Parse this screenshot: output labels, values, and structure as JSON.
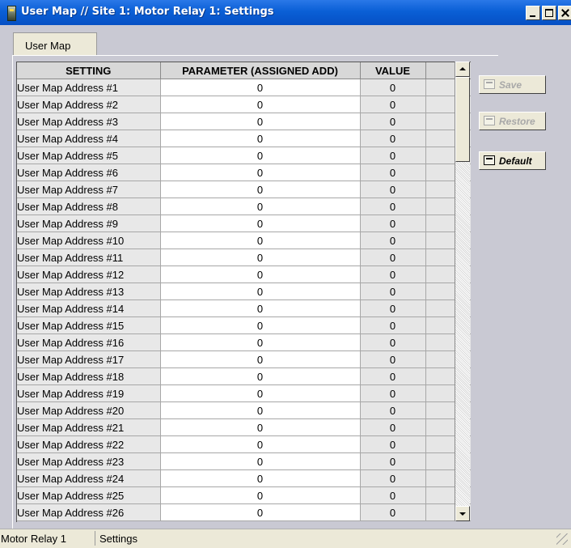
{
  "window": {
    "title": "User Map // Site 1: Motor Relay 1: Settings"
  },
  "tabs": [
    {
      "label": "User Map"
    }
  ],
  "table": {
    "columns": [
      "SETTING",
      "PARAMETER  (ASSIGNED ADD)",
      "VALUE",
      ""
    ],
    "rows": [
      {
        "setting": "User Map Address #1",
        "parameter": "0",
        "value": "0"
      },
      {
        "setting": "User Map Address #2",
        "parameter": "0",
        "value": "0"
      },
      {
        "setting": "User Map Address #3",
        "parameter": "0",
        "value": "0"
      },
      {
        "setting": "User Map Address #4",
        "parameter": "0",
        "value": "0"
      },
      {
        "setting": "User Map Address #5",
        "parameter": "0",
        "value": "0"
      },
      {
        "setting": "User Map Address #6",
        "parameter": "0",
        "value": "0"
      },
      {
        "setting": "User Map Address #7",
        "parameter": "0",
        "value": "0"
      },
      {
        "setting": "User Map Address #8",
        "parameter": "0",
        "value": "0"
      },
      {
        "setting": "User Map Address #9",
        "parameter": "0",
        "value": "0"
      },
      {
        "setting": "User Map Address #10",
        "parameter": "0",
        "value": "0"
      },
      {
        "setting": "User Map Address #11",
        "parameter": "0",
        "value": "0"
      },
      {
        "setting": "User Map Address #12",
        "parameter": "0",
        "value": "0"
      },
      {
        "setting": "User Map Address #13",
        "parameter": "0",
        "value": "0"
      },
      {
        "setting": "User Map Address #14",
        "parameter": "0",
        "value": "0"
      },
      {
        "setting": "User Map Address #15",
        "parameter": "0",
        "value": "0"
      },
      {
        "setting": "User Map Address #16",
        "parameter": "0",
        "value": "0"
      },
      {
        "setting": "User Map Address #17",
        "parameter": "0",
        "value": "0"
      },
      {
        "setting": "User Map Address #18",
        "parameter": "0",
        "value": "0"
      },
      {
        "setting": "User Map Address #19",
        "parameter": "0",
        "value": "0"
      },
      {
        "setting": "User Map Address #20",
        "parameter": "0",
        "value": "0"
      },
      {
        "setting": "User Map Address #21",
        "parameter": "0",
        "value": "0"
      },
      {
        "setting": "User Map Address #22",
        "parameter": "0",
        "value": "0"
      },
      {
        "setting": "User Map Address #23",
        "parameter": "0",
        "value": "0"
      },
      {
        "setting": "User Map Address #24",
        "parameter": "0",
        "value": "0"
      },
      {
        "setting": "User Map Address #25",
        "parameter": "0",
        "value": "0"
      },
      {
        "setting": "User Map Address #26",
        "parameter": "0",
        "value": "0"
      }
    ]
  },
  "buttons": {
    "save": {
      "label": "Save",
      "icon": "save-icon",
      "enabled": false
    },
    "restore": {
      "label": "Restore",
      "icon": "restore-icon",
      "enabled": false
    },
    "default": {
      "label": "Default",
      "icon": "default-icon",
      "enabled": true
    }
  },
  "statusbar": {
    "device": "Motor Relay 1",
    "section": "Settings"
  },
  "colors": {
    "titlebar": "#0a5fd6",
    "panel": "#c9c9d3",
    "setting_cell": "#e8e8e8",
    "parameter_cell": "#ffffff",
    "value_cell": "#e6e6e6",
    "disabled_text": "#a8a8a8"
  }
}
